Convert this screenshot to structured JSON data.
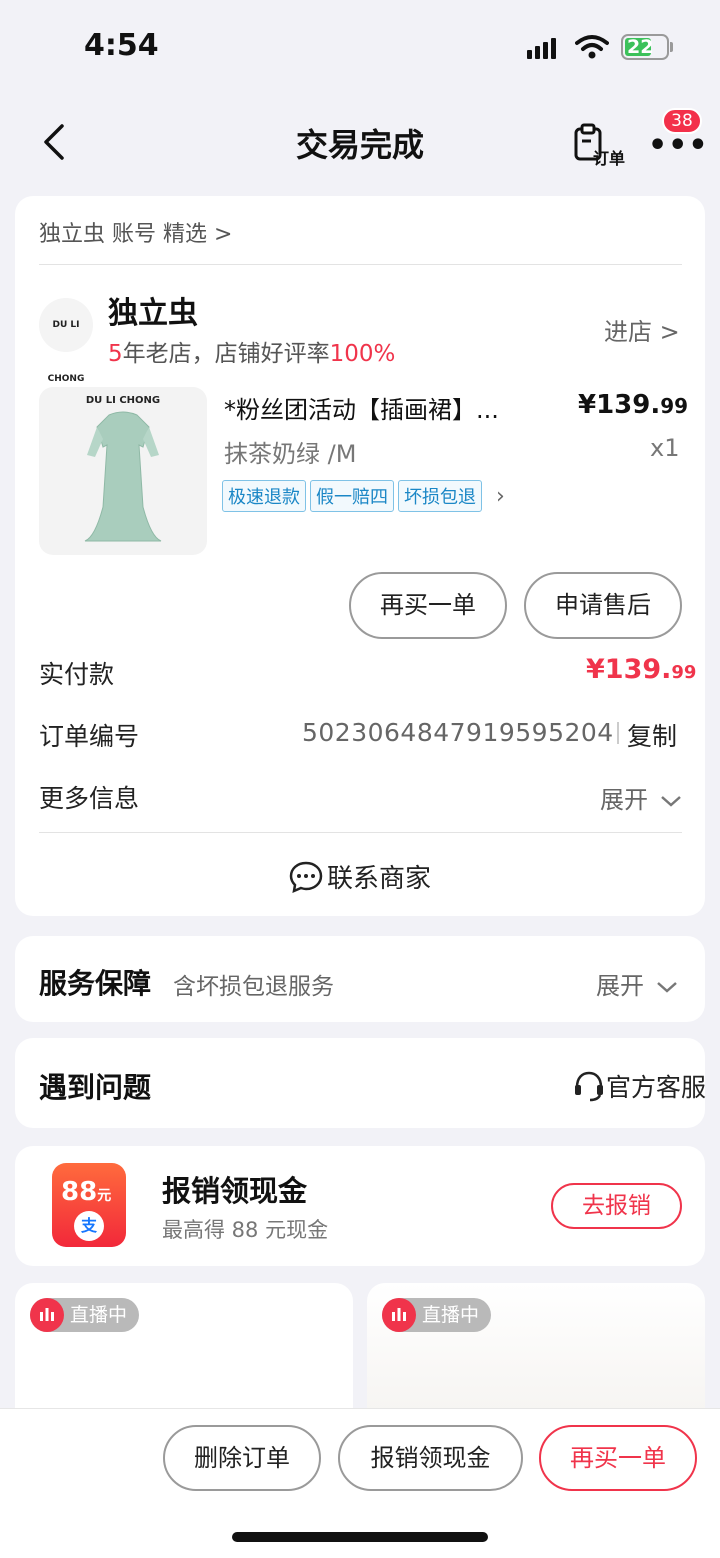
{
  "status": {
    "time": "4:54",
    "battery": "22"
  },
  "nav": {
    "title": "交易完成",
    "order_label": "订单",
    "badge": "38"
  },
  "shop": {
    "breadcrumb": "独立虫 账号 精选 >",
    "logo_text": "DU LI CHONG",
    "name": "独立虫",
    "years": "5",
    "sub_text": "年老店，店铺好评率",
    "rating": "100%",
    "enter": "进店 >"
  },
  "product": {
    "brand": "DU LI CHONG",
    "title": "*粉丝团活动【插画裙】...",
    "price_int": "¥139.",
    "price_dec": "99",
    "variant": "抹茶奶绿 /M",
    "qty": "x1",
    "tags": [
      "极速退款",
      "假一赔四",
      "坏损包退"
    ]
  },
  "actions": {
    "buy_again": "再买一单",
    "after_sale": "申请售后"
  },
  "payment": {
    "paid_label": "实付款",
    "paid_int": "¥139.",
    "paid_dec": "99",
    "order_label": "订单编号",
    "order_no": "5023064847919595204",
    "copy": "复制",
    "more_label": "更多信息",
    "expand": "展开",
    "contact": "联系商家"
  },
  "service": {
    "title": "服务保障",
    "sub": "含坏损包退服务",
    "expand": "展开"
  },
  "problem": {
    "title": "遇到问题",
    "service": "官方客服"
  },
  "cashback": {
    "badge_num": "88",
    "badge_unit": "元",
    "badge_symbol": "支",
    "title": "报销领现金",
    "sub": "最高得 88 元现金",
    "button": "去报销"
  },
  "live": {
    "label": "直播中"
  },
  "bottom": {
    "delete": "删除订单",
    "reimburse": "报销领现金",
    "buy_again": "再买一单"
  },
  "colors": {
    "accent": "#f0344b",
    "tag_blue": "#1b87c6",
    "bg": "#f2f2f7"
  }
}
